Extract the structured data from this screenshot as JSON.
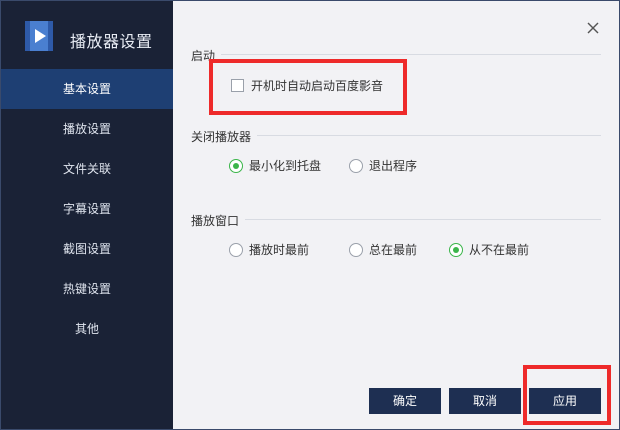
{
  "sidebar": {
    "app_title": "播放器设置",
    "logo_icon": "video-player-icon",
    "items": [
      {
        "label": "基本设置",
        "active": true
      },
      {
        "label": "播放设置"
      },
      {
        "label": "文件关联"
      },
      {
        "label": "字幕设置"
      },
      {
        "label": "截图设置"
      },
      {
        "label": "热键设置"
      },
      {
        "label": "其他"
      }
    ]
  },
  "window": {
    "close_icon": "close-icon"
  },
  "startup": {
    "title": "启动",
    "autostart_label": "开机时自动启动百度影音",
    "autostart_checked": false
  },
  "close_player": {
    "title": "关闭播放器",
    "options": [
      "最小化到托盘",
      "退出程序"
    ],
    "selected": 0
  },
  "play_window": {
    "title": "播放窗口",
    "options": [
      "播放时最前",
      "总在最前",
      "从不在最前"
    ],
    "selected": 2
  },
  "buttons": {
    "ok": "确定",
    "cancel": "取消",
    "apply": "应用"
  },
  "colors": {
    "sidebar_bg": "#1a2236",
    "active_item": "#1e3f73",
    "accent_green": "#3bb54a",
    "button_bg": "#1e2f52",
    "highlight_red": "#ee2a2a"
  }
}
